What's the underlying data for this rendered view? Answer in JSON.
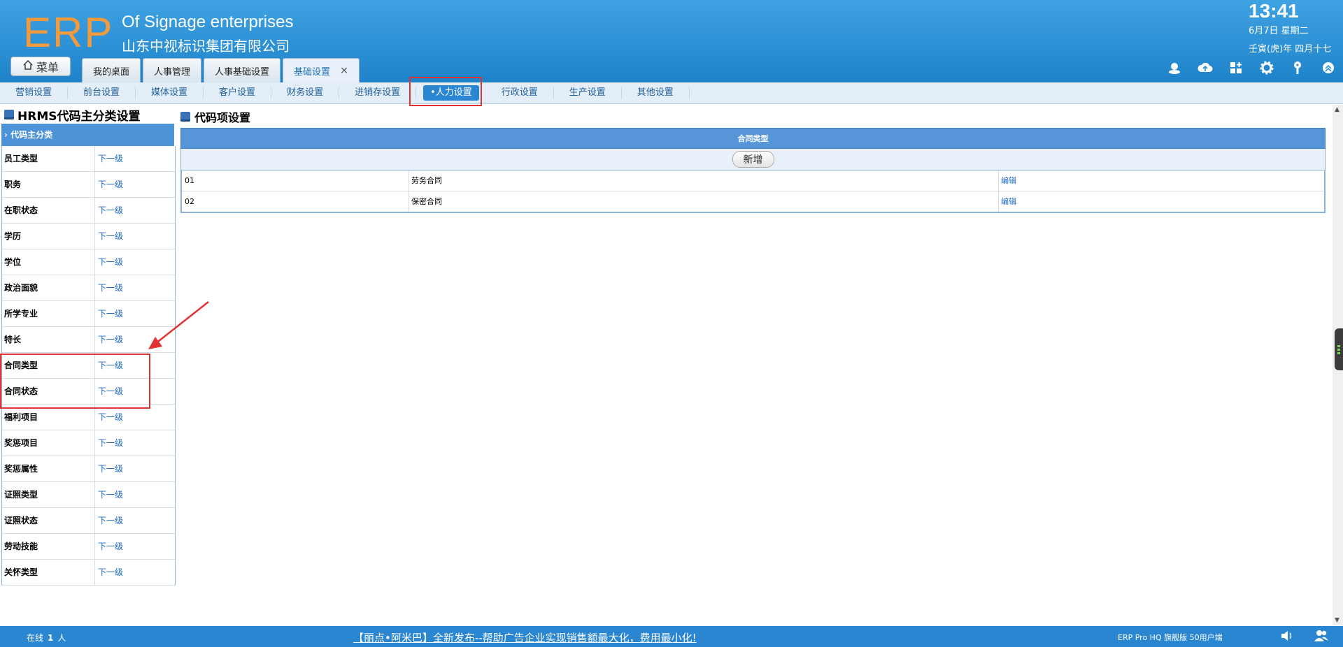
{
  "header": {
    "logo": "ERP",
    "company_en": "Of Signage enterprises",
    "company_cn": "山东中视标识集团有限公司",
    "time": "13:41",
    "date": "6月7日 星期二",
    "lunar": "壬寅(虎)年 四月十七",
    "menu_label": "菜单",
    "tabs": [
      {
        "label": "我的桌面"
      },
      {
        "label": "人事管理"
      },
      {
        "label": "人事基础设置"
      },
      {
        "label": "基础设置",
        "close": "×"
      }
    ],
    "tool_icons": [
      "user-icon",
      "cloud-upload-icon",
      "apps-icon",
      "gear-icon",
      "key-icon",
      "collapse-icon"
    ]
  },
  "subnav": {
    "items": [
      "营销设置",
      "前台设置",
      "媒体设置",
      "客户设置",
      "财务设置",
      "进销存设置",
      "•人力设置",
      "行政设置",
      "生产设置",
      "其他设置"
    ],
    "active_index": 6
  },
  "left_panel": {
    "title": "HRMS代码主分类设置",
    "category_header": "代码主分类",
    "rows": [
      {
        "name": "员工类型",
        "link": "下一级"
      },
      {
        "name": "职务",
        "link": "下一级"
      },
      {
        "name": "在职状态",
        "link": "下一级"
      },
      {
        "name": "学历",
        "link": "下一级"
      },
      {
        "name": "学位",
        "link": "下一级"
      },
      {
        "name": "政治面貌",
        "link": "下一级"
      },
      {
        "name": "所学专业",
        "link": "下一级"
      },
      {
        "name": "特长",
        "link": "下一级"
      },
      {
        "name": "合同类型",
        "link": "下一级"
      },
      {
        "name": "合同状态",
        "link": "下一级"
      },
      {
        "name": "福利项目",
        "link": "下一级"
      },
      {
        "name": "奖惩项目",
        "link": "下一级"
      },
      {
        "name": "奖惩属性",
        "link": "下一级"
      },
      {
        "name": "证照类型",
        "link": "下一级"
      },
      {
        "name": "证照状态",
        "link": "下一级"
      },
      {
        "name": "劳动技能",
        "link": "下一级"
      },
      {
        "name": "关怀类型",
        "link": "下一级"
      }
    ]
  },
  "right_panel": {
    "title": "代码项设置",
    "grid_title": "合同类型",
    "add_label": "新增",
    "rows": [
      {
        "code": "01",
        "name": "劳务合同",
        "action": "编辑"
      },
      {
        "code": "02",
        "name": "保密合同",
        "action": "编辑"
      }
    ]
  },
  "footer": {
    "online_prefix": "在线",
    "online_count": "1",
    "online_suffix": "人",
    "marquee": "【丽点•阿米巴】全新发布--帮助广告企业实现销售额最大化，费用最小化!",
    "version": "ERP Pro HQ 旗舰版 50用户端",
    "icons": [
      "volume-icon",
      "users-icon"
    ]
  },
  "colors": {
    "header_blue": "#2f93d8",
    "accent_orange": "#f29a3c",
    "highlight_red": "#e03333",
    "link_blue": "#1e6bc4"
  }
}
